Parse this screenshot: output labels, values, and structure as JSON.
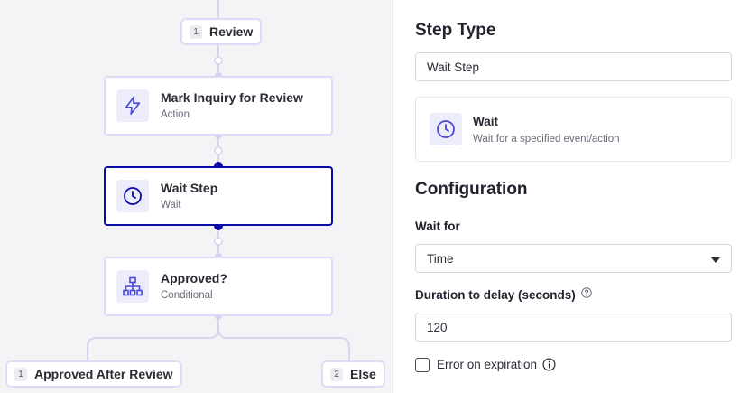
{
  "canvas": {
    "review_pill": {
      "number": "1",
      "label": "Review"
    },
    "nodes": [
      {
        "title": "Mark Inquiry for Review",
        "subtitle": "Action",
        "icon": "lightning-bolt-icon"
      },
      {
        "title": "Wait Step",
        "subtitle": "Wait",
        "icon": "clock-icon",
        "selected": true
      },
      {
        "title": "Approved?",
        "subtitle": "Conditional",
        "icon": "flowchart-icon"
      }
    ],
    "branches": [
      {
        "number": "1",
        "label": "Approved After Review"
      },
      {
        "number": "2",
        "label": "Else"
      }
    ]
  },
  "panel": {
    "step_type_heading": "Step Type",
    "step_type_value": "Wait Step",
    "type_card": {
      "title": "Wait",
      "description": "Wait for a specified event/action",
      "icon": "clock-icon"
    },
    "configuration_heading": "Configuration",
    "wait_for": {
      "label": "Wait for",
      "value": "Time",
      "options_icon": "caret-down-icon"
    },
    "duration": {
      "label": "Duration to delay (seconds)",
      "value": "120",
      "help_icon": "question-circle-icon"
    },
    "error_on_expiration": {
      "label": "Error on expiration",
      "checked": false,
      "info_icon": "info-circle-icon"
    }
  },
  "colors": {
    "accent": "#0b0ba8",
    "icon_blue": "#4a4ad9",
    "node_border": "#dcdcf6",
    "icon_bg": "#ececfb",
    "canvas_bg": "#f4f4f6"
  }
}
